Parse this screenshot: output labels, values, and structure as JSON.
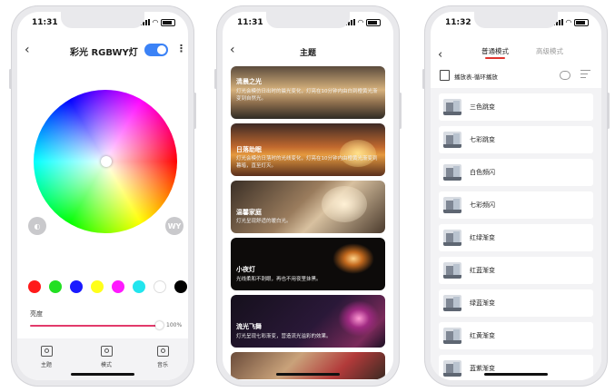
{
  "phones": [
    {
      "status": {
        "time": "11:31"
      },
      "header": {
        "title": "彩光 RGBWY灯"
      },
      "wheel": {
        "left_button": "◐",
        "right_button": "WY"
      },
      "swatches": [
        "#ff1a1a",
        "#22e022",
        "#1a1aff",
        "#ffff1a",
        "#ff1aff",
        "#22e5ee",
        "#ffffff",
        "#000000"
      ],
      "brightness": {
        "label": "亮度",
        "value": "100%",
        "level": 1.0
      },
      "tabbar": [
        {
          "label": "主题",
          "icon": "image-icon"
        },
        {
          "label": "模式",
          "icon": "mode-icon"
        },
        {
          "label": "音乐",
          "icon": "music-icon"
        }
      ]
    },
    {
      "status": {
        "time": "11:31"
      },
      "header": {
        "title": "主题"
      },
      "cards": [
        {
          "title": "清晨之光",
          "desc": "灯光会模仿日出时的晨光变化，灯亮在10分钟内由白到橙黄光渐变到自然光。"
        },
        {
          "title": "日落助眠",
          "desc": "灯光会模仿日落时的光线变化，灯亮在10分钟内由橙黄光渐变到暮暗，直至灯灭。"
        },
        {
          "title": "温馨家庭",
          "desc": "灯光呈现舒适的暖白光。"
        },
        {
          "title": "小夜灯",
          "desc": "光线柔和不刺眼，再也不用夜里抹黑。"
        },
        {
          "title": "流光飞舞",
          "desc": "灯光呈现七彩渐变，营造流光溢彩的效果。"
        }
      ]
    },
    {
      "status": {
        "time": "11:32"
      },
      "tabs": {
        "normal": "普通模式",
        "advanced": "高级模式"
      },
      "playlist": {
        "label": "播放表-循环播放"
      },
      "modes": [
        "三色跳变",
        "七彩跳变",
        "白色频闪",
        "七彩频闪",
        "红绿渐变",
        "红蓝渐变",
        "绿蓝渐变",
        "红黄渐变",
        "蓝紫渐变"
      ]
    }
  ]
}
